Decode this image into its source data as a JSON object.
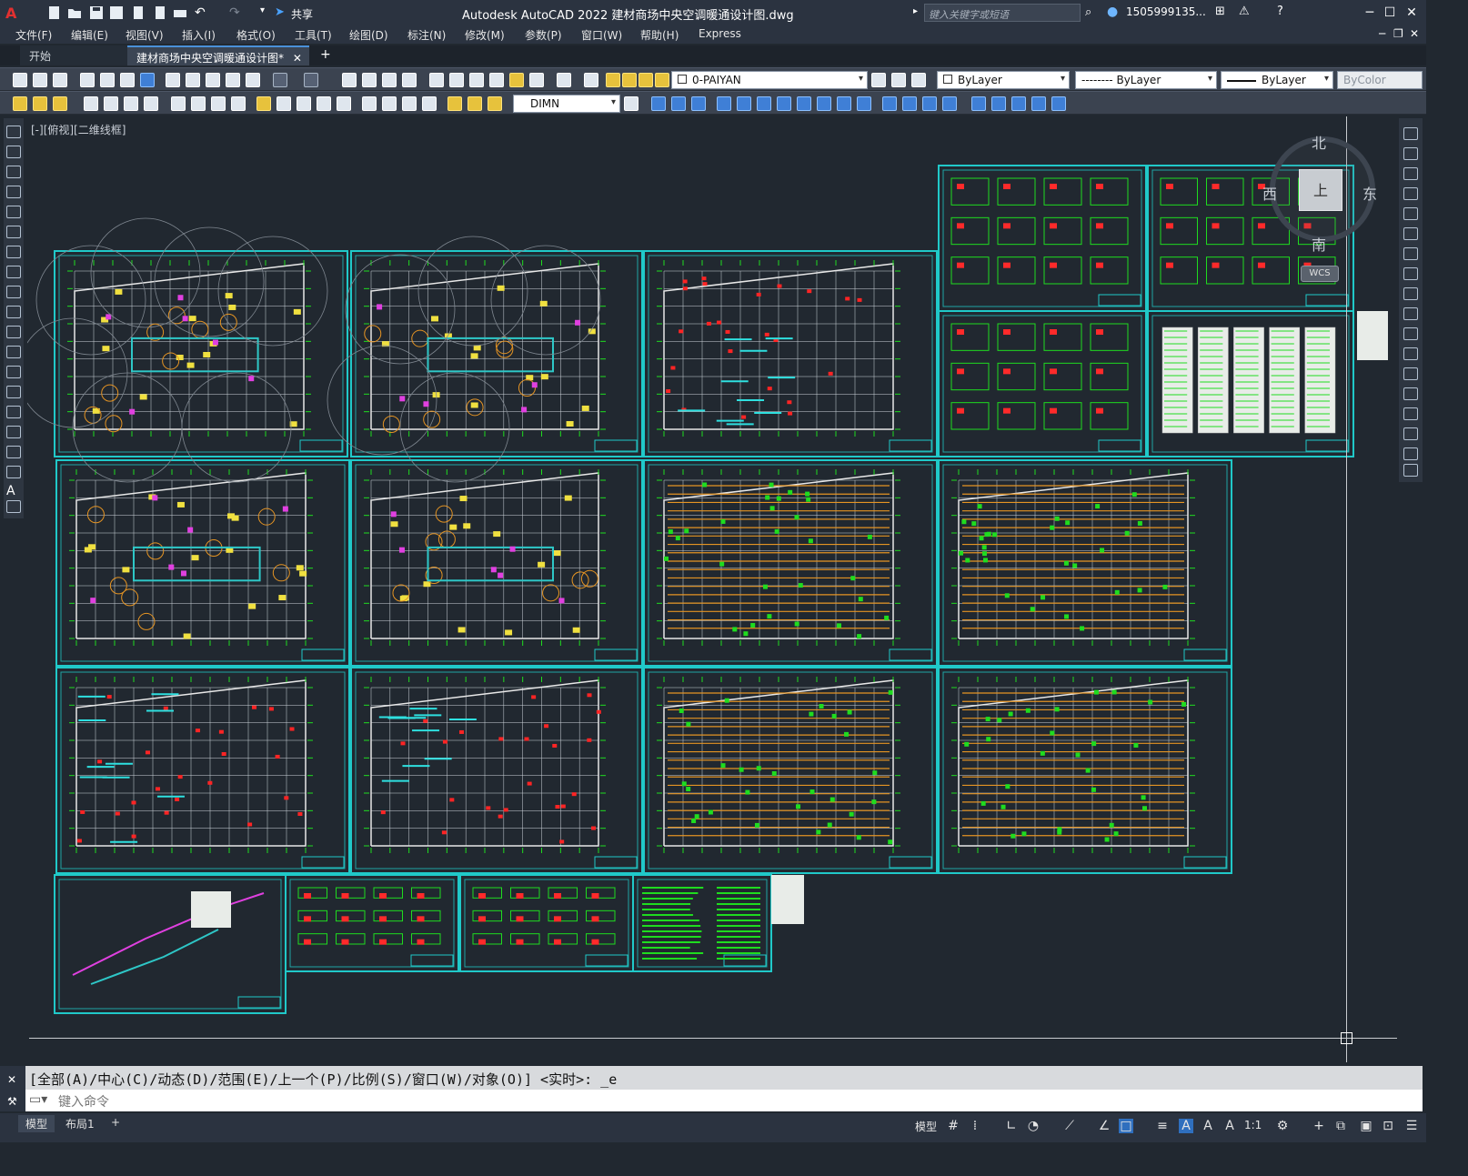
{
  "window": {
    "title": "Autodesk AutoCAD 2022    建材商场中央空调暖通设计图.dwg",
    "share_label": "共享",
    "search_placeholder": "键入关键字或短语",
    "user": "1505999135...",
    "controls": [
      "─",
      "☐",
      "✕"
    ]
  },
  "menu": [
    "文件(F)",
    "编辑(E)",
    "视图(V)",
    "插入(I)",
    "格式(O)",
    "工具(T)",
    "绘图(D)",
    "标注(N)",
    "修改(M)",
    "参数(P)",
    "窗口(W)",
    "帮助(H)",
    "Express"
  ],
  "tabs": {
    "start": "开始",
    "doc": "建材商场中央空调暖通设计图*",
    "close": "✕",
    "add": "+"
  },
  "toolbar": {
    "layer": "0-PAIYAN",
    "color": "ByLayer",
    "linetype": "-------- ByLayer",
    "lineweight": "ByLayer",
    "plotstyle": "ByColor",
    "dimstyle": "DIMN"
  },
  "viewport": {
    "label": "[-][俯视][二维线框]",
    "compass": {
      "north": "北",
      "south": "南",
      "east": "东",
      "west": "西",
      "top": "上"
    },
    "wcs": "WCS"
  },
  "command": {
    "history": "[全部(A)/中心(C)/动态(D)/范围(E)/上一个(P)/比例(S)/窗口(W)/对象(O)] <实时>: _e",
    "placeholder": "键入命令"
  },
  "status": {
    "model_tab": "模型",
    "layout_tab": "布局1",
    "add_tab": "+",
    "model_label": "模型",
    "scale": "1:1"
  },
  "colors": {
    "sheet_border": "#20c9c9",
    "grid": "#1fdc1f",
    "accent": "#e59423"
  }
}
